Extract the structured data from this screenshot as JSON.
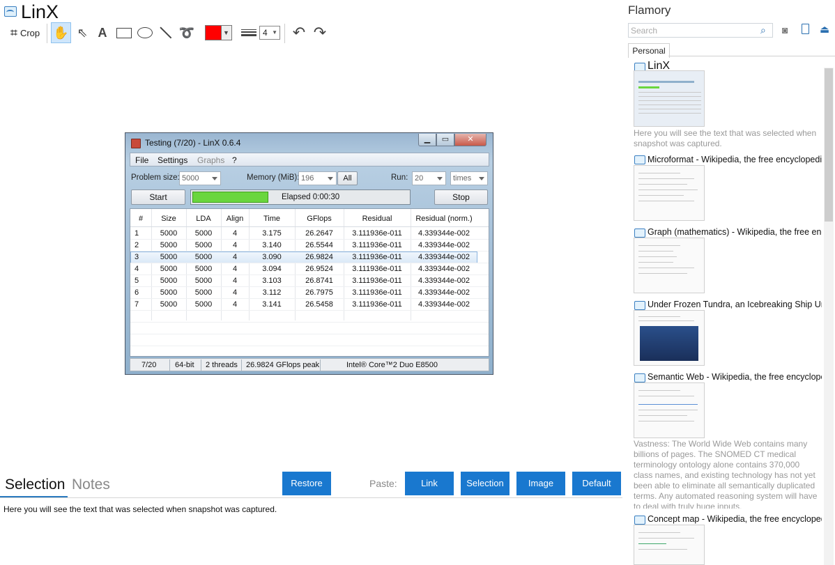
{
  "app": {
    "title": "LinX"
  },
  "toolbar": {
    "crop_label": "Crop",
    "line_width_value": "4",
    "color": "#ff0000"
  },
  "linx": {
    "window_title": "Testing (7/20) - LinX 0.6.4",
    "menu": [
      "File",
      "Settings",
      "Graphs",
      "?"
    ],
    "problem_size_label": "Problem size:",
    "problem_size_value": "5000",
    "memory_label": "Memory (MiB):",
    "memory_value": "196",
    "all_label": "All",
    "run_label": "Run:",
    "run_value": "20",
    "run_unit": "times",
    "start_label": "Start",
    "stop_label": "Stop",
    "progress_fraction": 0.35,
    "elapsed_text": "Elapsed 0:00:30",
    "columns": [
      "#",
      "Size",
      "LDA",
      "Align",
      "Time",
      "GFlops",
      "Residual",
      "Residual (norm.)"
    ],
    "rows": [
      [
        "1",
        "5000",
        "5000",
        "4",
        "3.175",
        "26.2647",
        "3.111936e-011",
        "4.339344e-002"
      ],
      [
        "2",
        "5000",
        "5000",
        "4",
        "3.140",
        "26.5544",
        "3.111936e-011",
        "4.339344e-002"
      ],
      [
        "3",
        "5000",
        "5000",
        "4",
        "3.090",
        "26.9824",
        "3.111936e-011",
        "4.339344e-002"
      ],
      [
        "4",
        "5000",
        "5000",
        "4",
        "3.094",
        "26.9524",
        "3.111936e-011",
        "4.339344e-002"
      ],
      [
        "5",
        "5000",
        "5000",
        "4",
        "3.103",
        "26.8741",
        "3.111936e-011",
        "4.339344e-002"
      ],
      [
        "6",
        "5000",
        "5000",
        "4",
        "3.112",
        "26.7975",
        "3.111936e-011",
        "4.339344e-002"
      ],
      [
        "7",
        "5000",
        "5000",
        "4",
        "3.141",
        "26.5458",
        "3.111936e-011",
        "4.339344e-002"
      ]
    ],
    "status": {
      "progress": "7/20",
      "bits": "64-bit",
      "threads": "2 threads",
      "peak": "26.9824 GFlops peak",
      "cpu": "Intel® Core™2 Duo E8500"
    }
  },
  "bottom": {
    "tab_selection": "Selection",
    "tab_notes": "Notes",
    "restore_label": "Restore",
    "paste_label": "Paste:",
    "paste_buttons": [
      "Link",
      "Selection",
      "Image",
      "Default"
    ],
    "selection_text": "Here you will see the text that was selected when snapshot was captured."
  },
  "sidebar": {
    "title": "Flamory",
    "search_placeholder": "Search",
    "tab_personal": "Personal",
    "entries": [
      {
        "title": "LinX",
        "desc": "Here you will see the text that was selected when snapshot was captured."
      },
      {
        "title": "Microformat - Wikipedia, the free encyclopedia"
      },
      {
        "title": "Graph (mathematics) - Wikipedia, the free ency"
      },
      {
        "title": "Under Frozen Tundra, an Icebreaking Ship Unco"
      },
      {
        "title": "Semantic Web - Wikipedia, the free encycloped",
        "desc": "Vastness: The World Wide Web contains many billions of pages. The SNOMED CT medical terminology ontology alone contains 370,000 class names, and existing technology has not yet been able to eliminate all semantically duplicated terms. Any automated reasoning system will have to deal with truly huge inputs."
      },
      {
        "title": "Concept map - Wikipedia, the free encyclopedi"
      }
    ]
  }
}
